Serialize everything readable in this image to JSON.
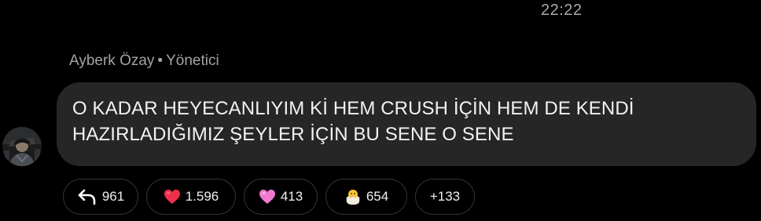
{
  "message": {
    "time": "22:22",
    "sender_name": "Ayberk Özay",
    "separator": "•",
    "sender_role": "Yönetici",
    "text": "O KADAR HEYECANLIYIM Kİ HEM CRUSH İÇİN HEM DE KENDİ HAZIRLADIĞIMIZ ŞEYLER İÇİN BU SENE O SENE"
  },
  "reactions": {
    "reply": {
      "icon": "reply-icon",
      "count": "961"
    },
    "red_heart": {
      "icon": "red-heart-icon",
      "count": "1.596"
    },
    "pink_heart": {
      "icon": "pink-heart-icon",
      "count": "413"
    },
    "chick": {
      "icon": "hatching-chick-icon",
      "count": "654"
    },
    "more": {
      "label": "+133"
    }
  },
  "colors": {
    "background": "#000000",
    "bubble": "#262626",
    "meta_text": "#a4a4a4",
    "red_heart": "#f0304a",
    "pink_heart": "#f07ad0",
    "chick": "#f7c531"
  }
}
